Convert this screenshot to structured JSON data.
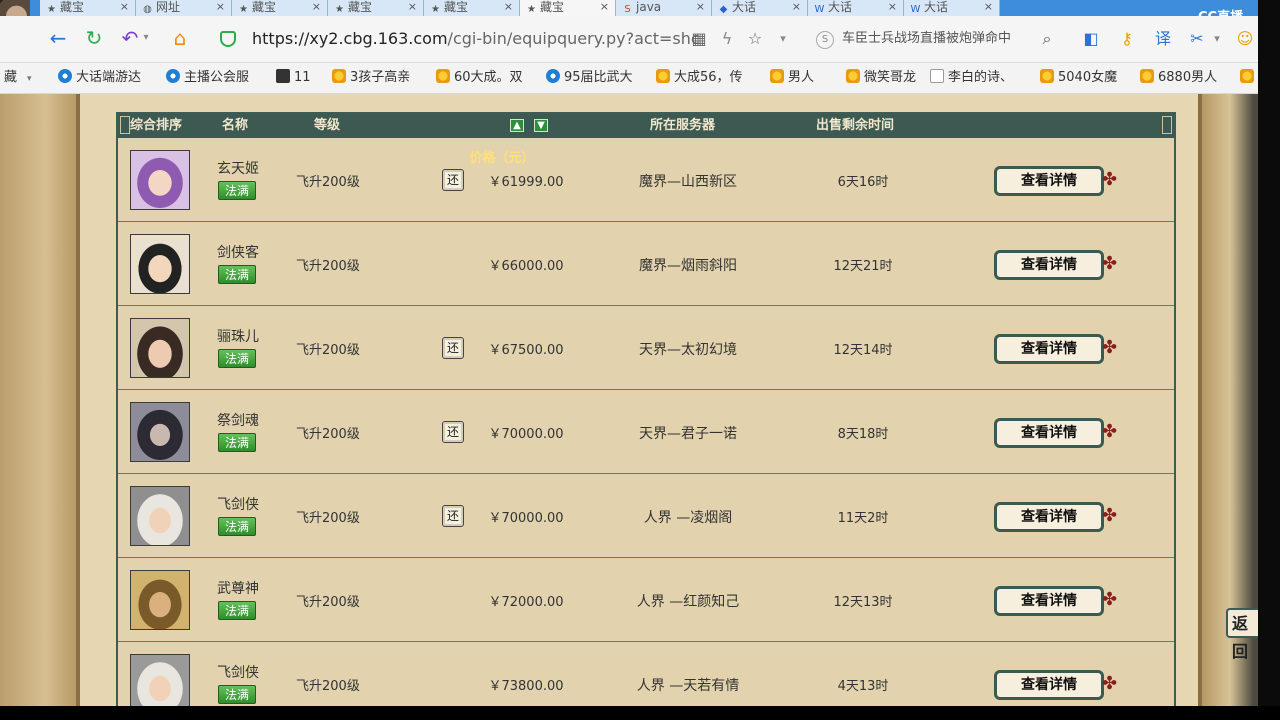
{
  "browser": {
    "tabs": [
      {
        "label": "藏宝",
        "icon": "star",
        "active": false
      },
      {
        "label": "网址",
        "icon": "globe",
        "active": false
      },
      {
        "label": "藏宝",
        "icon": "star",
        "active": false
      },
      {
        "label": "藏宝",
        "icon": "star",
        "active": false
      },
      {
        "label": "藏宝",
        "icon": "star",
        "active": false
      },
      {
        "label": "藏宝",
        "icon": "star",
        "active": true
      },
      {
        "label": "java",
        "icon": "s",
        "active": false
      },
      {
        "label": "大话",
        "icon": "game",
        "active": false
      },
      {
        "label": "大话",
        "icon": "w",
        "active": false
      },
      {
        "label": "大话",
        "icon": "w",
        "active": false
      }
    ],
    "cc_label": "CC直播",
    "url_host": "https://xy2.cbg.163.com",
    "url_path": "/cgi-bin/equipquery.py?act=shc",
    "search_text": "车臣士兵战场直播被炮弹命中"
  },
  "bookmarks": [
    {
      "label": "藏",
      "icon": "none"
    },
    {
      "label": "大话端游达",
      "icon": "blue"
    },
    {
      "label": "主播公会服",
      "icon": "blue"
    },
    {
      "label": "11",
      "icon": "dark"
    },
    {
      "label": "3孩子高亲",
      "icon": "star"
    },
    {
      "label": "60大成。双",
      "icon": "star"
    },
    {
      "label": "95届比武大",
      "icon": "blue"
    },
    {
      "label": "大成56，传",
      "icon": "star"
    },
    {
      "label": "男人",
      "icon": "star"
    },
    {
      "label": "微笑哥龙",
      "icon": "star"
    },
    {
      "label": "李白的诗、",
      "icon": "cut"
    },
    {
      "label": "5040女魔",
      "icon": "star"
    },
    {
      "label": "6880男人",
      "icon": "star"
    }
  ],
  "table": {
    "headers": {
      "rank": "综合排序",
      "name": "名称",
      "level": "等级",
      "price": "价格（元）",
      "server": "所在服务器",
      "time_left": "出售剩余时间"
    },
    "huan_label": "还",
    "detail_label": "查看详情",
    "rows": [
      {
        "name": "玄天姬",
        "tag": "法满",
        "level": "飞升200级",
        "huan": true,
        "price": "￥61999.00",
        "server": "魔界—山西新区",
        "time_left": "6天16时"
      },
      {
        "name": "剑侠客",
        "tag": "法满",
        "level": "飞升200级",
        "huan": false,
        "price": "￥66000.00",
        "server": "魔界—烟雨斜阳",
        "time_left": "12天21时"
      },
      {
        "name": "骊珠儿",
        "tag": "法满",
        "level": "飞升200级",
        "huan": true,
        "price": "￥67500.00",
        "server": "天界—太初幻境",
        "time_left": "12天14时"
      },
      {
        "name": "祭剑魂",
        "tag": "法满",
        "level": "飞升200级",
        "huan": true,
        "price": "￥70000.00",
        "server": "天界—君子一诺",
        "time_left": "8天18时"
      },
      {
        "name": "飞剑侠",
        "tag": "法满",
        "level": "飞升200级",
        "huan": true,
        "price": "￥70000.00",
        "server": "人界 —凌烟阁",
        "time_left": "11天2时"
      },
      {
        "name": "武尊神",
        "tag": "法满",
        "level": "飞升200级",
        "huan": false,
        "price": "￥72000.00",
        "server": "人界 —红颜知己",
        "time_left": "12天13时"
      },
      {
        "name": "飞剑侠",
        "tag": "法满",
        "level": "飞升200级",
        "huan": false,
        "price": "￥73800.00",
        "server": "人界 —天若有情",
        "time_left": "4天13时"
      }
    ]
  },
  "side_tab_label": "返回"
}
